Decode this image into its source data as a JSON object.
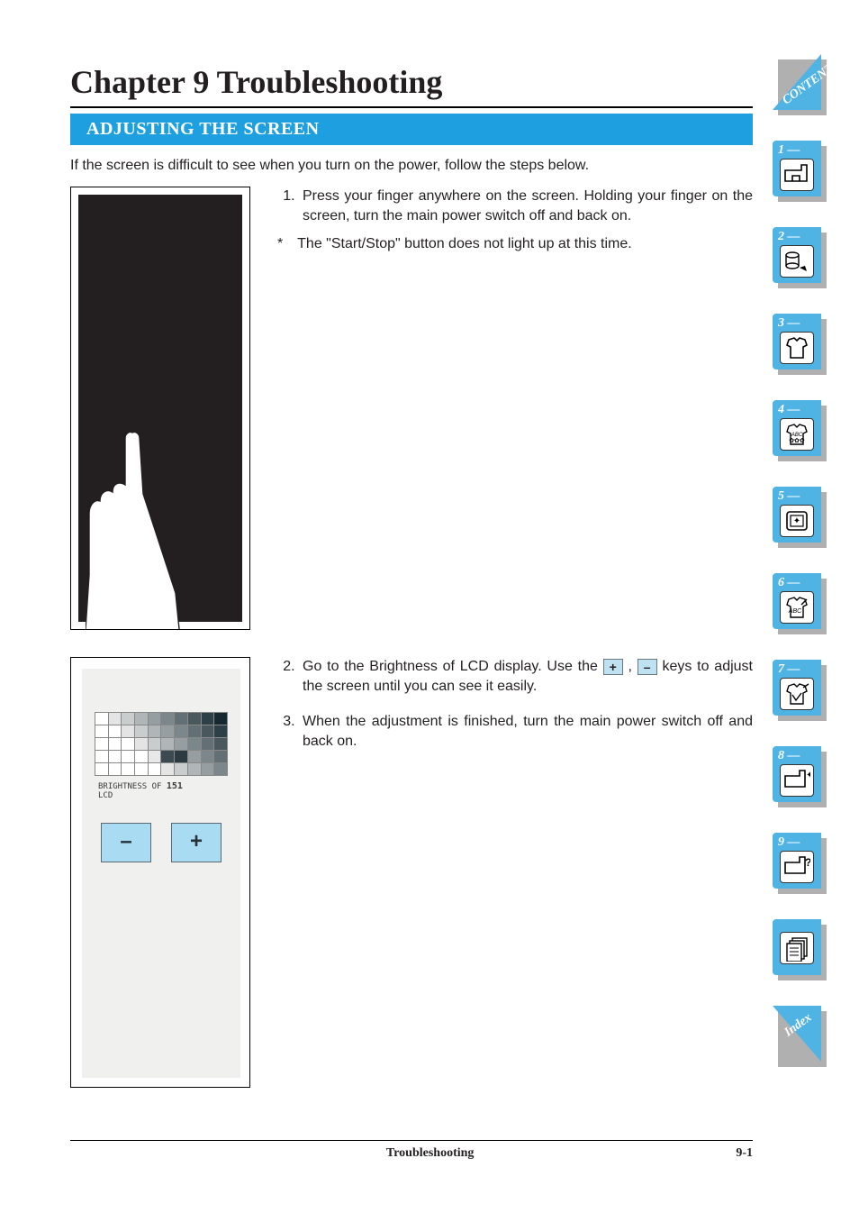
{
  "chapter_title": "Chapter 9 Troubleshooting",
  "section_heading": "ADJUSTING THE SCREEN",
  "intro_text": "If the screen is difficult to see when you turn on the power, follow the steps below.",
  "steps_block1": {
    "step1": "Press your finger anywhere on the screen. Holding your finger on the screen, turn the main power switch off and back on.",
    "note_marker": "*",
    "note": "The \"Start/Stop\" button does not light up at this time."
  },
  "steps_block2": {
    "step2_pre": "Go to the Brightness of LCD display. Use the ",
    "plus": "+",
    "comma": " , ",
    "minus": "–",
    "step2_post": " keys to adjust the screen until you can see it easily.",
    "step3": "When the adjustment is finished, turn the main power switch off and back on."
  },
  "lcd_screen": {
    "label_line1": "BRIGHTNESS OF",
    "label_value": "151",
    "label_line2": "LCD",
    "minus_btn": "–",
    "plus_btn": "+"
  },
  "footer": {
    "center": "Troubleshooting",
    "right": "9-1"
  },
  "tabs": {
    "contents": "CONTENTS",
    "t1": "1 —",
    "t2": "2 —",
    "t3": "3 —",
    "t4": "4 —",
    "t5": "5 —",
    "t6": "6 —",
    "t7": "7 —",
    "t8": "8 —",
    "t9": "9 —",
    "index": "Index"
  }
}
